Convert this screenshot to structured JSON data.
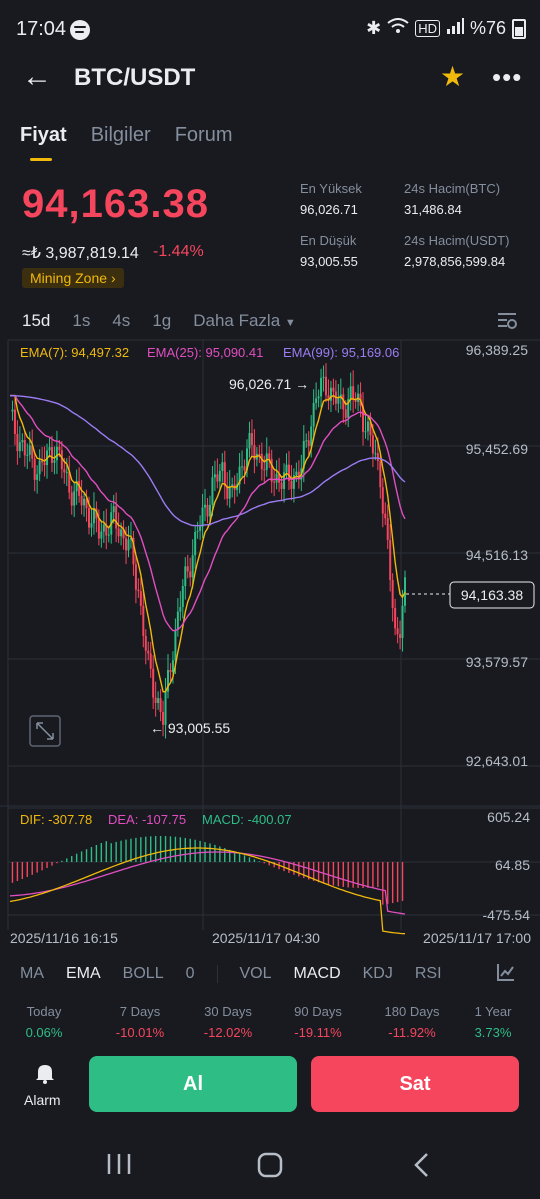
{
  "status_bar": {
    "time": "17:04",
    "icons": [
      "spotify-icon",
      "bluetooth-icon",
      "wifi-icon",
      "hd-icon",
      "signal-icon"
    ],
    "battery": "%76"
  },
  "header": {
    "title": "BTC/USDT"
  },
  "tabs": [
    {
      "label": "Fiyat",
      "active": true
    },
    {
      "label": "Bilgiler"
    },
    {
      "label": "Forum"
    }
  ],
  "price": {
    "last": "94,163.38",
    "fiat": "≈₺ 3,987,819.14",
    "change": "-1.44%",
    "badge": "Mining Zone"
  },
  "stats": {
    "high_label": "En Yüksek",
    "high": "96,026.71",
    "low_label": "En Düşük",
    "low": "93,005.55",
    "vol_btc_label": "24s Hacim(BTC)",
    "vol_btc": "31,486.84",
    "vol_usdt_label": "24s Hacim(USDT)",
    "vol_usdt": "2,978,856,599.84"
  },
  "timeframes": [
    "15d",
    "1s",
    "4s",
    "1g",
    "Daha Fazla"
  ],
  "chart": {
    "ema7": "EMA(7): 94,497.32",
    "ema25": "EMA(25): 95,090.41",
    "ema99": "EMA(99): 95,169.06",
    "y_ticks": [
      "96,389.25",
      "95,452.69",
      "94,516.13",
      "93,579.57",
      "92,643.01"
    ],
    "current_price": "94,163.38",
    "high_marker": "96,026.71",
    "low_marker": "93,005.55",
    "dif": "DIF: -307.78",
    "dea": "DEA: -107.75",
    "macd": "MACD: -400.07",
    "macd_ticks": [
      "605.24",
      "64.85",
      "-475.54"
    ],
    "x_ticks": [
      "2025/11/16 16:15",
      "2025/11/17 04:30",
      "2025/11/17 17:00"
    ],
    "colors": {
      "up": "#2ebd85",
      "down": "#f6465d",
      "ema7": "#f0b90b",
      "ema25": "#e04ec0",
      "ema99": "#9c7cf2"
    }
  },
  "indicators": {
    "main": [
      "MA",
      "EMA",
      "BOLL",
      "0"
    ],
    "sub": [
      "VOL",
      "MACD",
      "KDJ",
      "RSI"
    ],
    "active_main": "EMA",
    "active_sub": "MACD"
  },
  "performance": [
    {
      "label": "Today",
      "value": "0.06%",
      "dir": "up"
    },
    {
      "label": "7 Days",
      "value": "-10.01%",
      "dir": "down"
    },
    {
      "label": "30 Days",
      "value": "-12.02%",
      "dir": "down"
    },
    {
      "label": "90 Days",
      "value": "-19.11%",
      "dir": "down"
    },
    {
      "label": "180 Days",
      "value": "-11.92%",
      "dir": "down"
    },
    {
      "label": "1 Year",
      "value": "3.73%",
      "dir": "up"
    }
  ],
  "actions": {
    "alarm": "Alarm",
    "buy": "Al",
    "sell": "Sat"
  }
}
